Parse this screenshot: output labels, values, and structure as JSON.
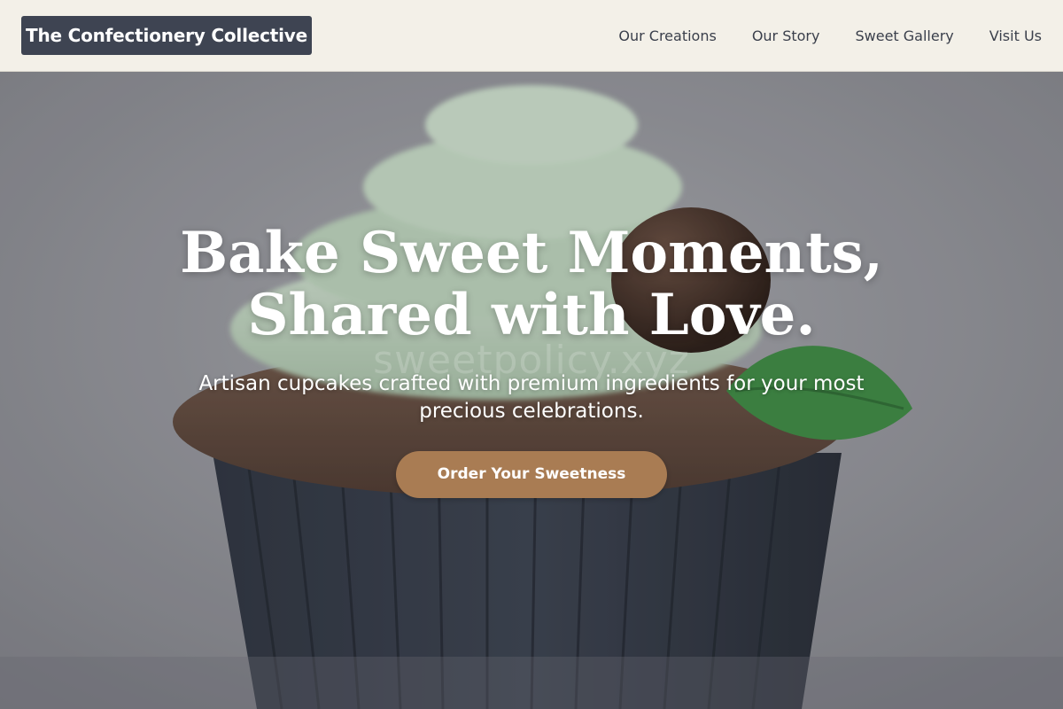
{
  "header": {
    "brand": "The Confectionery Collective",
    "nav": [
      {
        "label": "Our Creations"
      },
      {
        "label": "Our Story"
      },
      {
        "label": "Sweet Gallery"
      },
      {
        "label": "Visit Us"
      }
    ]
  },
  "hero": {
    "headline_line1": "Bake Sweet Moments,",
    "headline_line2": "Shared with Love.",
    "subtext": "Artisan cupcakes crafted with premium ingredients for your most precious celebrations.",
    "cta_label": "Order Your Sweetness",
    "watermark": "sweetpolicy.xyz",
    "image": "chocolate-cupcake-with-mint-frosting-photo"
  },
  "colors": {
    "header_bg": "#f3f0e8",
    "brand_bg": "#3e4452",
    "cta_bg": "#a97c53",
    "nav_text": "#3a3f4b"
  }
}
